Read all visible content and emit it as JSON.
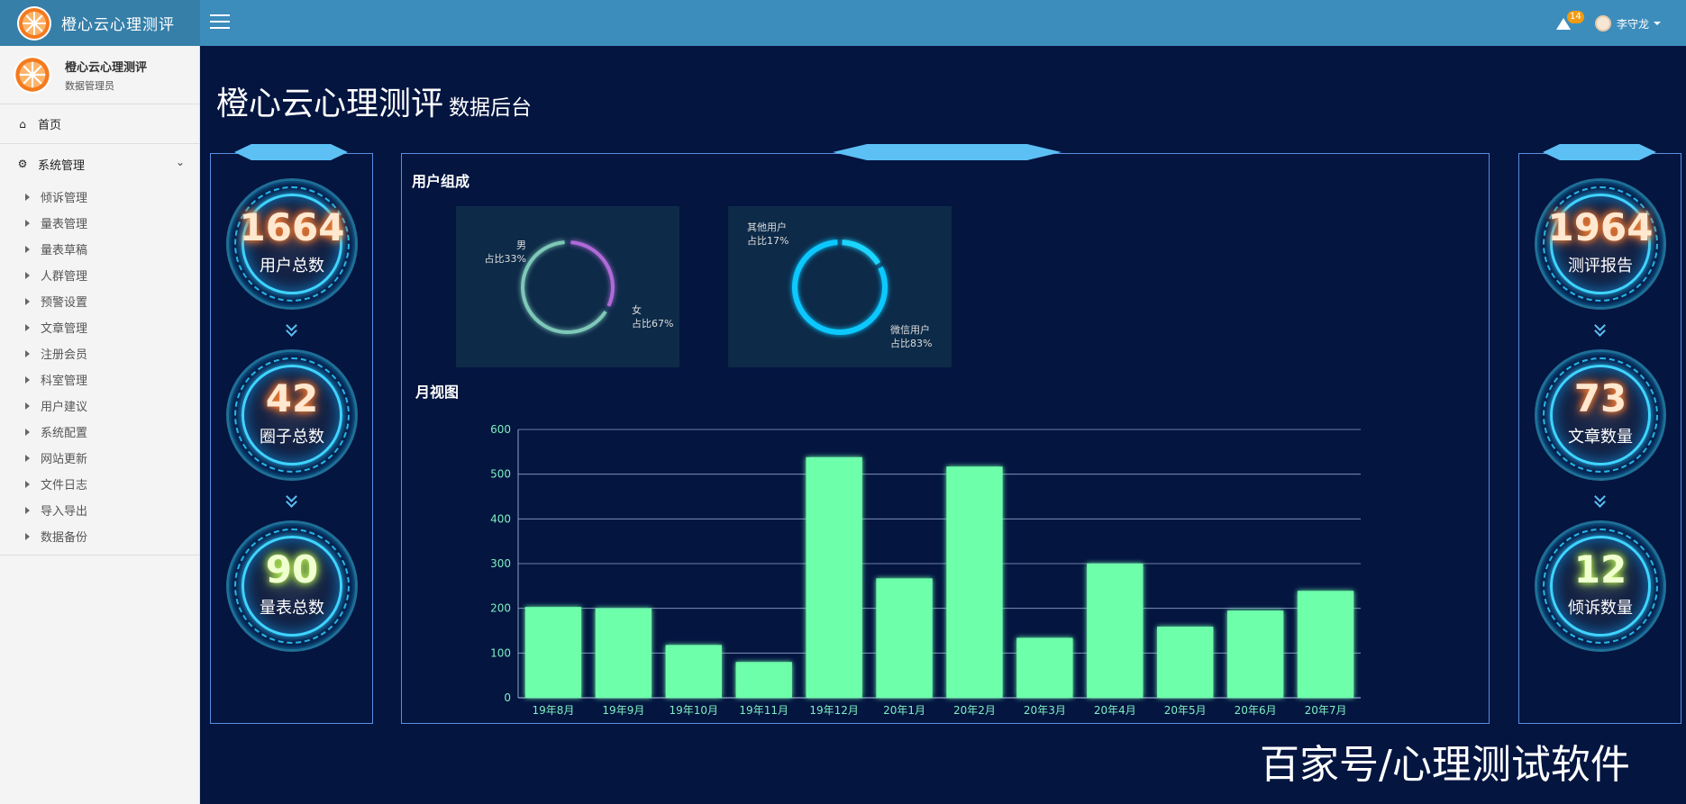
{
  "app": {
    "brand_title": "橙心云心理测评",
    "alert_count": "14",
    "user_name": "李守龙"
  },
  "sidebar": {
    "user_name": "橙心云心理测评",
    "user_role": "数据管理员",
    "home_label": "首页",
    "group_label": "系统管理",
    "items": [
      "倾诉管理",
      "量表管理",
      "量表草稿",
      "人群管理",
      "预警设置",
      "文章管理",
      "注册会员",
      "科室管理",
      "用户建议",
      "系统配置",
      "网站更新",
      "文件日志",
      "导入导出",
      "数据备份"
    ]
  },
  "page": {
    "title": "橙心云心理测评",
    "subtitle": "数据后台"
  },
  "stats_left": [
    {
      "value": "1664",
      "label": "用户总数"
    },
    {
      "value": "42",
      "label": "圈子总数"
    },
    {
      "value": "90",
      "label": "量表总数"
    }
  ],
  "stats_right": [
    {
      "value": "1964",
      "label": "测评报告"
    },
    {
      "value": "73",
      "label": "文章数量"
    },
    {
      "value": "12",
      "label": "倾诉数量"
    }
  ],
  "composition": {
    "title": "用户组成",
    "gender": [
      {
        "name": "男",
        "text": "占比33%",
        "share": 33,
        "color": "#b06bd8"
      },
      {
        "name": "女",
        "text": "占比67%",
        "share": 67,
        "color": "#7ec8b8"
      }
    ],
    "channel": [
      {
        "name": "其他用户",
        "text": "占比17%",
        "share": 17,
        "color": "#1fd6ff"
      },
      {
        "name": "微信用户",
        "text": "占比83%",
        "share": 83,
        "color": "#0fc8ff"
      }
    ]
  },
  "monthly": {
    "title": "月视图"
  },
  "chart_data": {
    "type": "bar",
    "categories": [
      "19年8月",
      "19年9月",
      "19年10月",
      "19年11月",
      "19年12月",
      "20年1月",
      "20年2月",
      "20年3月",
      "20年4月",
      "20年5月",
      "20年6月",
      "20年7月"
    ],
    "values": [
      203,
      200,
      118,
      80,
      538,
      267,
      517,
      134,
      300,
      159,
      195,
      239
    ],
    "ylim": [
      0,
      600
    ],
    "yticks": [
      0,
      100,
      200,
      300,
      400,
      500,
      600
    ],
    "bar_color": "#6effaa",
    "grid": true
  },
  "watermark": "百家号/心理测试软件"
}
